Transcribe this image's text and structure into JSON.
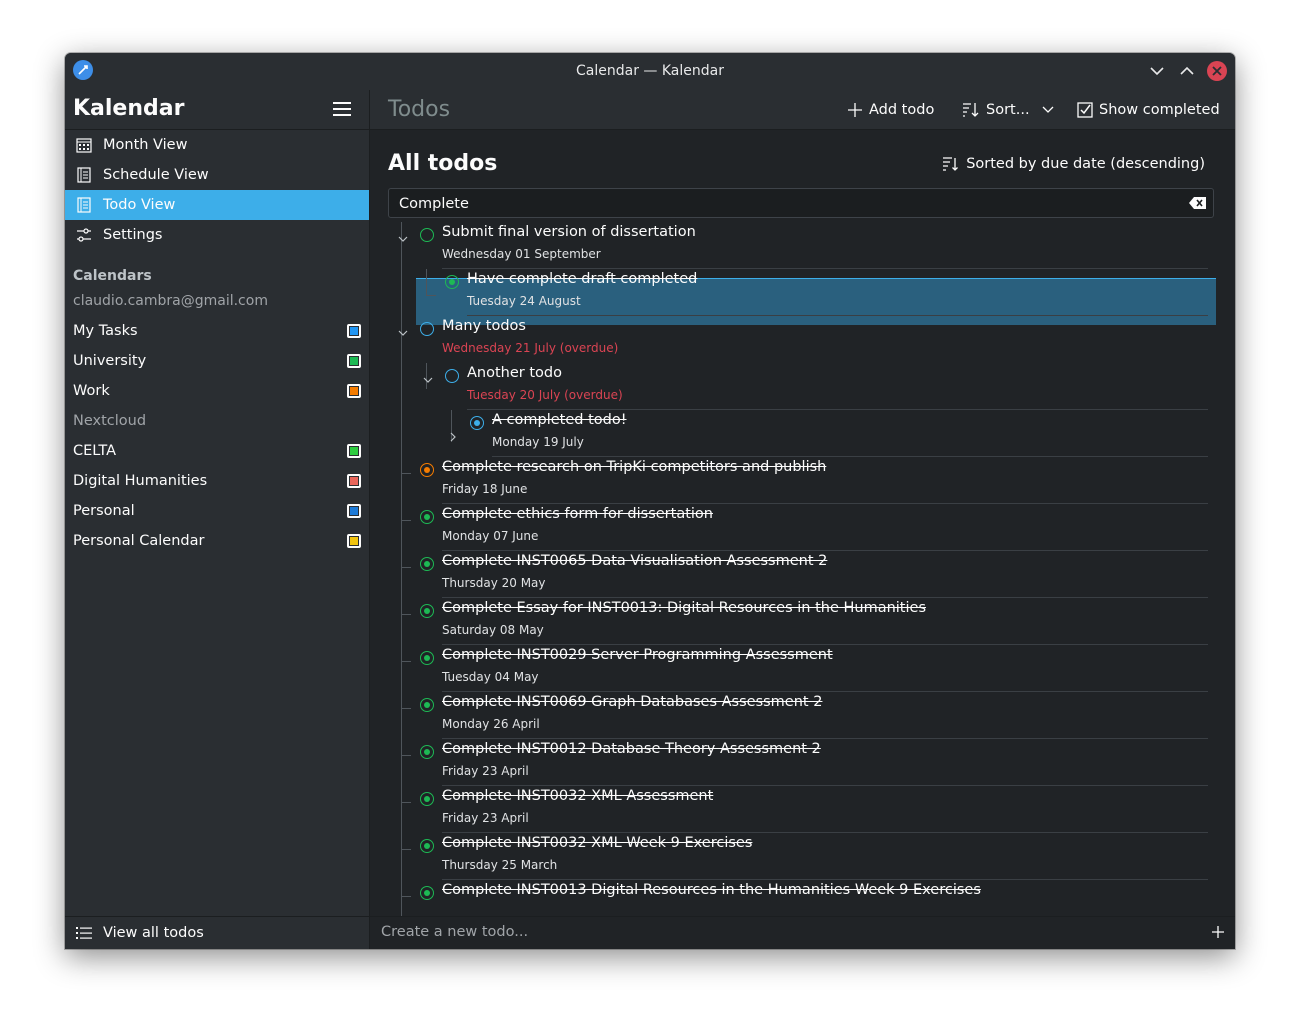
{
  "window": {
    "title": "Calendar — Kalendar"
  },
  "sidebar": {
    "title": "Kalendar",
    "nav": [
      {
        "label": "Month View",
        "icon": "calendar-grid-icon"
      },
      {
        "label": "Schedule View",
        "icon": "schedule-list-icon"
      },
      {
        "label": "Todo View",
        "icon": "todo-list-icon",
        "active": true
      },
      {
        "label": "Settings",
        "icon": "settings-sliders-icon"
      }
    ],
    "calendars_title": "Calendars",
    "account": "claudio.cambra@gmail.com",
    "calendars": [
      {
        "label": "My Tasks",
        "color": "#2196f3"
      },
      {
        "label": "University",
        "color": "#1db954"
      },
      {
        "label": "Work",
        "color": "#f57c00"
      },
      {
        "label": "Nextcloud",
        "color": ""
      },
      {
        "label": "CELTA",
        "color": "#2ecc40"
      },
      {
        "label": "Digital Humanities",
        "color": "#e8655a"
      },
      {
        "label": "Personal",
        "color": "#1e7bd8"
      },
      {
        "label": "Personal Calendar",
        "color": "#f1c40f"
      }
    ],
    "footer_label": "View all todos"
  },
  "toolbar": {
    "page_title": "Todos",
    "add_label": "Add todo",
    "sort_label": "Sort...",
    "show_completed_label": "Show completed"
  },
  "main": {
    "section_title": "All todos",
    "sorted_label": "Sorted by due date (descending)",
    "search_value": "Complete",
    "new_todo_placeholder": "Create a new todo..."
  },
  "todos": [
    {
      "title": "Submit final version of dissertation",
      "date": "Wednesday 01 September",
      "done": false,
      "overdue": false,
      "color": "#1db954"
    },
    {
      "title": "Have complete draft completed",
      "date": "Tuesday 24 August",
      "done": true,
      "overdue": false,
      "color": "#1db954"
    },
    {
      "title": "Many todos",
      "date": "Wednesday 21 July (overdue)",
      "done": false,
      "overdue": true,
      "color": "#3daee9"
    },
    {
      "title": "Another todo",
      "date": "Tuesday 20 July (overdue)",
      "done": false,
      "overdue": true,
      "color": "#3daee9"
    },
    {
      "title": "A completed todo!",
      "date": "Monday 19 July",
      "done": true,
      "overdue": false,
      "color": "#3daee9"
    },
    {
      "title": "Complete research on TripKi competitors and publish",
      "date": "Friday 18 June",
      "done": true,
      "overdue": false,
      "color": "#f57c00"
    },
    {
      "title": "Complete ethics form for dissertation",
      "date": "Monday 07 June",
      "done": true,
      "overdue": false,
      "color": "#1db954"
    },
    {
      "title": "Complete INST0065 Data Visualisation Assessment 2",
      "date": "Thursday 20 May",
      "done": true,
      "overdue": false,
      "color": "#1db954"
    },
    {
      "title": "Complete Essay for INST0013: Digital Resources in the Humanities",
      "date": "Saturday 08 May",
      "done": true,
      "overdue": false,
      "color": "#1db954"
    },
    {
      "title": "Complete INST0029 Server Programming Assessment",
      "date": "Tuesday 04 May",
      "done": true,
      "overdue": false,
      "color": "#1db954"
    },
    {
      "title": "Complete INST0069 Graph Databases Assessment 2",
      "date": "Monday 26 April",
      "done": true,
      "overdue": false,
      "color": "#1db954"
    },
    {
      "title": "Complete INST0012 Database Theory Assessment 2",
      "date": "Friday 23 April",
      "done": true,
      "overdue": false,
      "color": "#1db954"
    },
    {
      "title": "Complete INST0032 XML Assessment",
      "date": "Friday 23 April",
      "done": true,
      "overdue": false,
      "color": "#1db954"
    },
    {
      "title": "Complete INST0032 XML Week 9 Exercises",
      "date": "Thursday 25 March",
      "done": true,
      "overdue": false,
      "color": "#1db954"
    },
    {
      "title": "Complete INST0013 Digital Resources in the Humanities Week 9 Exercises",
      "date": "",
      "done": true,
      "overdue": false,
      "color": "#1db954"
    }
  ]
}
